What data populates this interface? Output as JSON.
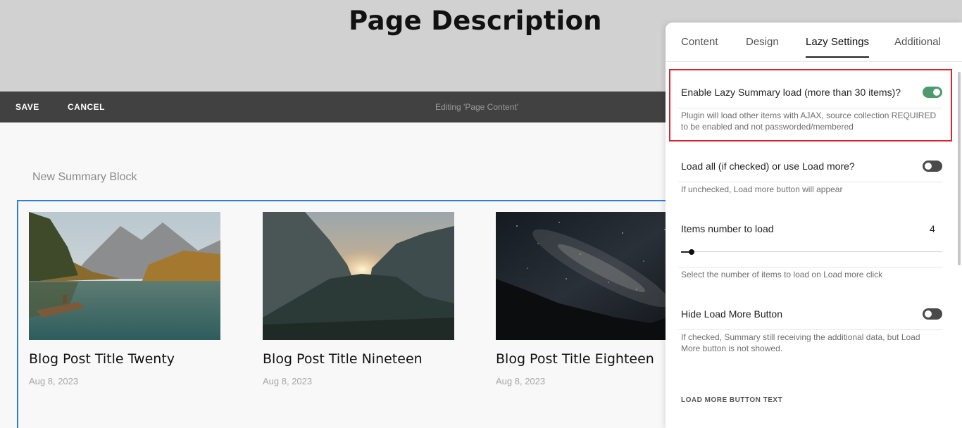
{
  "page": {
    "title": "Page Description"
  },
  "toolbar": {
    "save_label": "SAVE",
    "cancel_label": "CANCEL",
    "editing_label": "Editing 'Page Content'"
  },
  "block": {
    "label": "New Summary Block"
  },
  "posts": [
    {
      "title": "Blog Post Title Twenty",
      "date": "Aug 8, 2023"
    },
    {
      "title": "Blog Post Title Nineteen",
      "date": "Aug 8, 2023"
    },
    {
      "title": "Blog Post Title Eighteen",
      "date": "Aug 8, 2023"
    }
  ],
  "panel": {
    "tabs": [
      {
        "label": "Content",
        "active": false
      },
      {
        "label": "Design",
        "active": false
      },
      {
        "label": "Lazy Settings",
        "active": true
      },
      {
        "label": "Additional",
        "active": false
      }
    ],
    "lazy_load": {
      "label": "Enable Lazy Summary load (more than 30 items)?",
      "enabled": true,
      "help": "Plugin will load other items with AJAX, source collection REQUIRED to be enabled and not passworded/membered"
    },
    "load_all": {
      "label": "Load all (if checked) or use Load more?",
      "enabled": false,
      "help": "If unchecked, Load more button will appear"
    },
    "items_number": {
      "label": "Items number to load",
      "value": "4",
      "help": "Select the number of items to load on Load more click"
    },
    "hide_button": {
      "label": "Hide Load More Button",
      "enabled": false,
      "help": "If checked, Summary still receiving the additional data, but Load More button is not showed."
    },
    "load_more_text_caption": "LOAD MORE BUTTON TEXT"
  },
  "colors": {
    "accent": "#2f7de1",
    "toggle_on": "#4c9a6d",
    "highlight": "#d7262e",
    "toolbar": "#414141"
  }
}
